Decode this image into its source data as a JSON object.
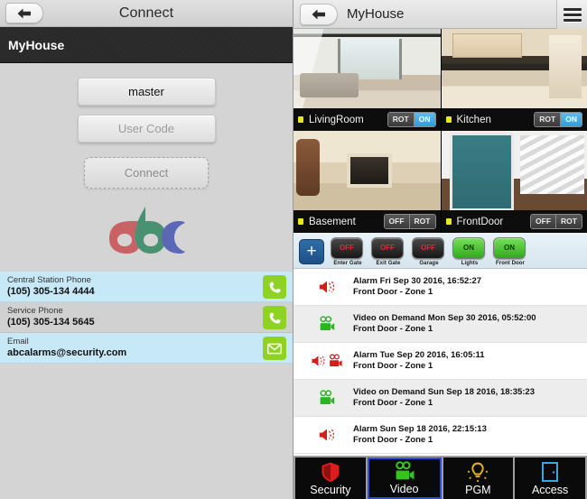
{
  "left": {
    "titlebar": {
      "back_icon": "back-arrow-icon",
      "title": "Connect"
    },
    "header": {
      "site_name": "MyHouse"
    },
    "form": {
      "username_value": "master",
      "usercode_placeholder": "User Code",
      "usercode_value": "",
      "connect_label": "Connect"
    },
    "logo": {
      "name": "abc-logo",
      "colors": [
        "#c96265",
        "#4a9172",
        "#5a68b5"
      ]
    },
    "contacts": [
      {
        "label": "Central Station Phone",
        "value": "(105) 305-134 4444",
        "icon": "phone-icon",
        "style": "blue"
      },
      {
        "label": "Service Phone",
        "value": "(105) 305-134 5645",
        "icon": "phone-icon",
        "style": "grey"
      },
      {
        "label": "Email",
        "value": "abcalarms@security.com",
        "icon": "envelope-icon",
        "style": "blue"
      }
    ]
  },
  "right": {
    "titlebar": {
      "back_icon": "back-arrow-icon",
      "title": "MyHouse",
      "menu_icon": "hamburger-menu-icon"
    },
    "cameras": [
      {
        "name": "LivingRoom",
        "photo": "ph-living",
        "led": "#e8e81e",
        "buttons": [
          {
            "text": "ROT",
            "state": "off"
          },
          {
            "text": "ON",
            "state": "on"
          }
        ]
      },
      {
        "name": "Kitchen",
        "photo": "ph-kitchen",
        "led": "#e8e81e",
        "buttons": [
          {
            "text": "ROT",
            "state": "off"
          },
          {
            "text": "ON",
            "state": "on"
          }
        ]
      },
      {
        "name": "Basement",
        "photo": "ph-basement",
        "led": "#e8e81e",
        "buttons": [
          {
            "text": "OFF",
            "state": "off"
          },
          {
            "text": "ROT",
            "state": "off"
          }
        ]
      },
      {
        "name": "FrontDoor",
        "photo": "ph-frontdoor",
        "led": "#e8e81e",
        "buttons": [
          {
            "text": "OFF",
            "state": "off"
          },
          {
            "text": "ROT",
            "state": "off"
          }
        ]
      }
    ],
    "pgm": {
      "add_label": "+",
      "items": [
        {
          "label": "Enter Gate",
          "state": "OFF"
        },
        {
          "label": "Exit Gate",
          "state": "OFF"
        },
        {
          "label": "Garage",
          "state": "OFF"
        },
        {
          "label": "Lights",
          "state": "ON"
        },
        {
          "label": "Front Door",
          "state": "ON"
        }
      ]
    },
    "events": [
      {
        "icons": [
          "alarm-speaker-icon"
        ],
        "title": "Alarm Fri Sep 30 2016, 16:52:27",
        "subtitle": "Front Door - Zone 1"
      },
      {
        "icons": [
          "video-camera-icon"
        ],
        "title": "Video on Demand Mon Sep 30 2016, 05:52:00",
        "subtitle": "Front Door - Zone 1"
      },
      {
        "icons": [
          "alarm-speaker-icon",
          "video-camera-icon"
        ],
        "title": "Alarm Tue Sep 20 2016, 16:05:11",
        "subtitle": "Front Door - Zone 1"
      },
      {
        "icons": [
          "video-camera-icon"
        ],
        "title": "Video on Demand Sun Sep 18 2016, 18:35:23",
        "subtitle": "Front Door - Zone 1"
      },
      {
        "icons": [
          "alarm-speaker-icon"
        ],
        "title": "Alarm Sun Sep 18 2016, 22:15:13",
        "subtitle": "Front Door - Zone 1"
      }
    ],
    "tabs": [
      {
        "label": "Security",
        "icon": "shield-icon",
        "color": "#e01b1b",
        "active": false
      },
      {
        "label": "Video",
        "icon": "video-camera-icon",
        "color": "#35c41d",
        "active": true
      },
      {
        "label": "PGM",
        "icon": "bulb-icon",
        "color": "#e8b51c",
        "active": false
      },
      {
        "label": "Access",
        "icon": "door-icon",
        "color": "#3aa7e0",
        "active": false
      }
    ]
  }
}
